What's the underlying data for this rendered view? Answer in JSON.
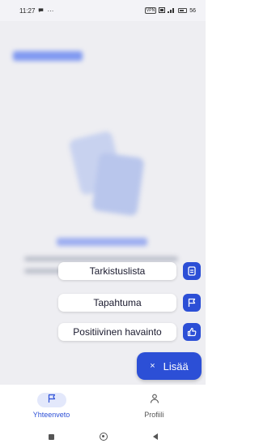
{
  "status_bar": {
    "time": "11:27",
    "extra": "···",
    "chip": "VPN",
    "battery": "56"
  },
  "fab_menu": {
    "items": [
      {
        "label": "Tarkistuslista",
        "icon": "checklist-icon"
      },
      {
        "label": "Tapahtuma",
        "icon": "flag-icon"
      },
      {
        "label": "Positiivinen havainto",
        "icon": "thumbs-up-icon"
      }
    ],
    "add_label": "Lisää",
    "close_glyph": "×"
  },
  "bottom_nav": {
    "items": [
      {
        "label": "Yhteenveto",
        "icon": "flag-icon",
        "active": true
      },
      {
        "label": "Profiili",
        "icon": "person-icon",
        "active": false
      }
    ]
  },
  "colors": {
    "accent": "#2c4fd6",
    "accent_light": "#e3e8fb",
    "scrim": "#eeeef2"
  }
}
